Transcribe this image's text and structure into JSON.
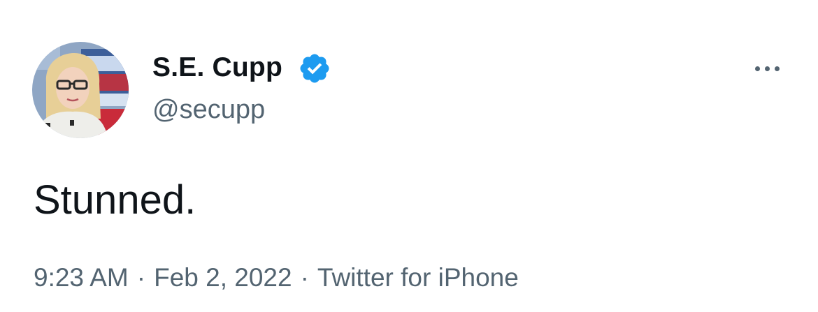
{
  "author": {
    "display_name": "S.E. Cupp",
    "handle": "@secupp",
    "verified": true,
    "avatar_icon": "profile-photo"
  },
  "tweet": {
    "text": "Stunned.",
    "time": "9:23 AM",
    "date": "Feb 2, 2022",
    "source": "Twitter for iPhone",
    "separator": "·"
  },
  "icons": {
    "verified": "verified-badge-icon",
    "more": "more-options-icon"
  },
  "colors": {
    "verified_blue": "#1d9bf0",
    "text_primary": "#0f1419",
    "text_secondary": "#536471"
  }
}
